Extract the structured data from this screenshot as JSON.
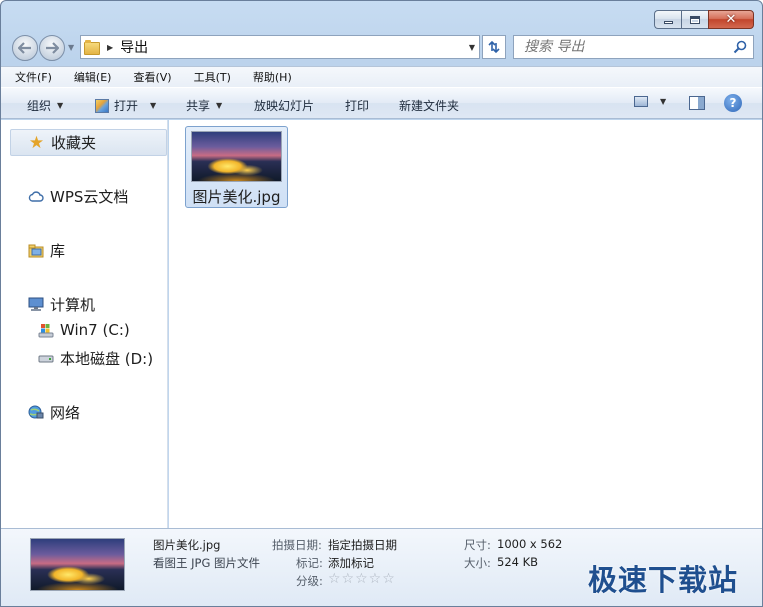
{
  "window": {
    "caption_close": "✕"
  },
  "address_bar": {
    "path": "导出"
  },
  "search": {
    "placeholder": "搜索 导出"
  },
  "menu": [
    {
      "label": "文件(F)"
    },
    {
      "label": "编辑(E)"
    },
    {
      "label": "查看(V)"
    },
    {
      "label": "工具(T)"
    },
    {
      "label": "帮助(H)"
    }
  ],
  "toolbar": {
    "organize": "组织",
    "open": "打开",
    "share": "共享",
    "slideshow": "放映幻灯片",
    "print": "打印",
    "new_folder": "新建文件夹",
    "help": "?"
  },
  "nav_pane": {
    "favorites": "收藏夹",
    "wps": "WPS云文档",
    "library": "库",
    "computer": "计算机",
    "drive_c": "Win7 (C:)",
    "drive_d": "本地磁盘 (D:)",
    "network": "网络"
  },
  "files": [
    {
      "name": "图片美化.jpg"
    }
  ],
  "details": {
    "filename": "图片美化.jpg",
    "filetype": "看图王 JPG 图片文件",
    "date_label": "拍摄日期:",
    "date_value": "指定拍摄日期",
    "tags_label": "标记:",
    "tags_value": "添加标记",
    "rating_label": "分级:",
    "rating_stars": "☆☆☆☆☆",
    "rating": 0,
    "dimensions_label": "尺寸:",
    "dimensions_value": "1000 x 562",
    "size_label": "大小:",
    "size_value": "524 KB"
  },
  "watermark": "极速下载站",
  "colors": {
    "accent": "#1f4f8f",
    "close_button": "#c2452c",
    "selection": "#cfe0f5"
  }
}
